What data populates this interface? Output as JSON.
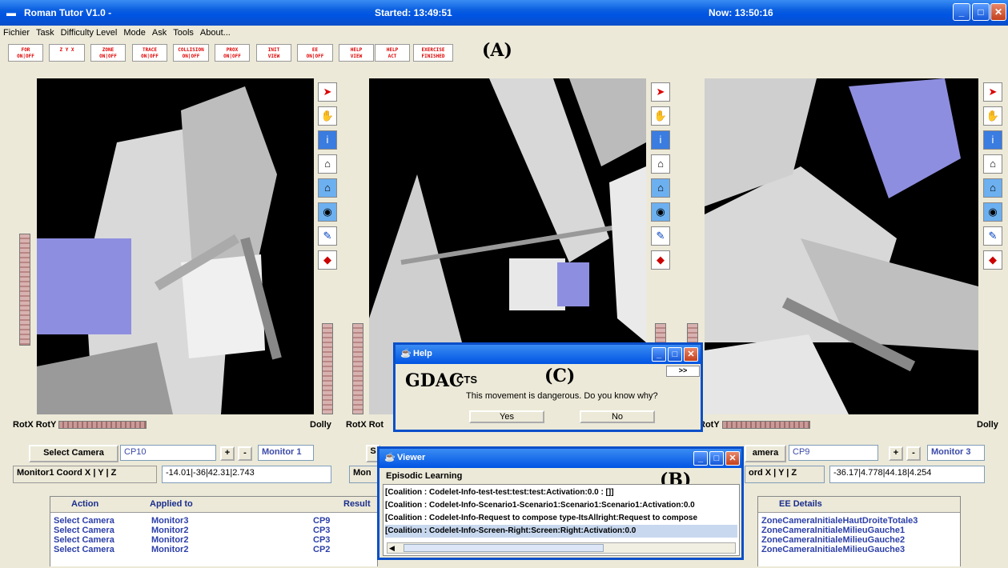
{
  "app": {
    "title": "Roman Tutor V1.0 -",
    "started": "Started: 13:49:51",
    "now": "Now: 13:50:16"
  },
  "menu": [
    "Fichier",
    "Task",
    "Difficulty Level",
    "Mode",
    "Ask",
    "Tools",
    "About..."
  ],
  "toolbar": [
    [
      "FOR",
      "ON|OFF"
    ],
    [
      "Z Y X",
      ""
    ],
    [
      "ZONE",
      "ON|OFF"
    ],
    [
      "TRACE",
      "ON|OFF"
    ],
    [
      "COLLISION",
      "ON|OFF"
    ],
    [
      "PROX",
      "ON|OFF"
    ],
    [
      "INIT",
      "VIEW"
    ],
    [
      "EE",
      "ON|OFF"
    ],
    [
      "HELP",
      "VIEW"
    ],
    [
      "HELP",
      "ACT"
    ],
    [
      "EXERCISE",
      "FINISHED"
    ]
  ],
  "labels": {
    "a": "(A)",
    "b": "(B)",
    "c": "(C)"
  },
  "viewport": {
    "rotx": "RotX",
    "roty": "RotY",
    "dolly": "Dolly"
  },
  "camera": {
    "select": "Select Camera",
    "left_cam": "CP10",
    "plus": "+",
    "minus": "-",
    "left_monitor": "Monitor 1",
    "coord_label": "Monitor1 Coord X | Y | Z",
    "left_coord": "-14.01|-36|42.31|2.743",
    "mid_select": "S",
    "mid_coord": "Mon",
    "right_select": "amera",
    "right_cam": "CP9",
    "right_monitor": "Monitor 3",
    "right_coord_label": "ord X | Y | Z",
    "right_coord": "-36.17|4.778|44.18|4.254"
  },
  "actions": {
    "headers": [
      "Action",
      "Applied to",
      "Result"
    ],
    "rows": [
      [
        "Select Camera",
        "Monitor3",
        "CP9"
      ],
      [
        "Select Camera",
        "Monitor2",
        "CP3"
      ],
      [
        "Select Camera",
        "Monitor2",
        "CP3"
      ],
      [
        "Select Camera",
        "Monitor2",
        "CP2"
      ]
    ]
  },
  "ee": {
    "header": "EE Details",
    "rows": [
      "ZoneCameraInitialeHautDroiteTotale3",
      "ZoneCameraInitialeMilieuGauche1",
      "ZoneCameraInitialeMilieuGauche2",
      "ZoneCameraInitialeMilieuGauche3"
    ]
  },
  "help": {
    "title": "Help",
    "more": ">>",
    "logo": "GDAC",
    "heading": "CTS",
    "message": "This movement is dangerous. Do you know why?",
    "yes": "Yes",
    "no": "No"
  },
  "viewer": {
    "title": "Viewer",
    "group": "Episodic Learning",
    "items": [
      "[Coalition : Codelet-Info-test-test:test:test:Activation:0.0 : []]",
      "[Coalition : Codelet-Info-Scenario1-Scenario1:Scenario1:Scenario1:Activation:0.0",
      "[Coalition : Codelet-Info-Request to compose type-ItsAllright:Request to compose",
      "[Coalition : Codelet-Info-Screen-Right:Screen:Right:Activation:0.0"
    ]
  }
}
